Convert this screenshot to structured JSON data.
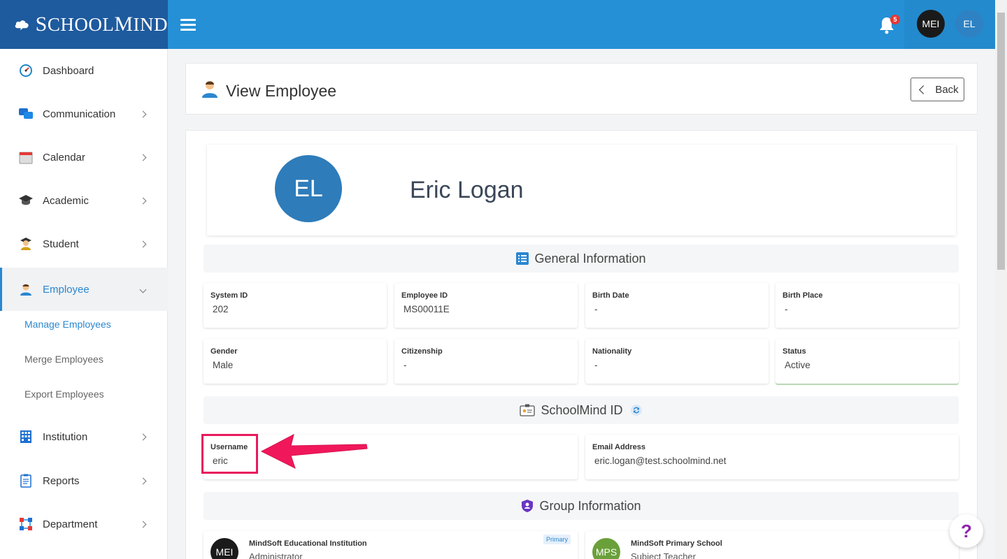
{
  "brand": {
    "name_first_letter": "S",
    "name_part1": "CHOOL",
    "name_second_letter": "M",
    "name_part2": "IND"
  },
  "topbar": {
    "notification_count": "5",
    "user_avatar_mei": "MEI",
    "user_avatar_el": "EL"
  },
  "sidebar": {
    "items": [
      {
        "label": "Dashboard"
      },
      {
        "label": "Communication"
      },
      {
        "label": "Calendar"
      },
      {
        "label": "Academic"
      },
      {
        "label": "Student"
      },
      {
        "label": "Employee"
      },
      {
        "label": "Institution"
      },
      {
        "label": "Reports"
      },
      {
        "label": "Department"
      }
    ],
    "employee_subitems": [
      {
        "label": "Manage Employees"
      },
      {
        "label": "Merge Employees"
      },
      {
        "label": "Export Employees"
      }
    ]
  },
  "header": {
    "title": "View Employee",
    "back_label": "Back"
  },
  "profile": {
    "initials": "EL",
    "name": "Eric Logan"
  },
  "general": {
    "title": "General Information",
    "fields": [
      {
        "label": "System ID",
        "value": "202"
      },
      {
        "label": "Employee ID",
        "value": "MS00011E"
      },
      {
        "label": "Birth Date",
        "value": "-"
      },
      {
        "label": "Birth Place",
        "value": "-"
      },
      {
        "label": "Gender",
        "value": "Male"
      },
      {
        "label": "Citizenship",
        "value": "-"
      },
      {
        "label": "Nationality",
        "value": "-"
      },
      {
        "label": "Status",
        "value": "Active"
      }
    ]
  },
  "schoolmind_id": {
    "title": "SchoolMind ID",
    "fields": [
      {
        "label": "Username",
        "value": "eric"
      },
      {
        "label": "Email Address",
        "value": "eric.logan@test.schoolmind.net"
      }
    ]
  },
  "groups": {
    "title": "Group Information",
    "items": [
      {
        "initials": "MEI",
        "title": "MindSoft Educational Institution",
        "role": "Administrator",
        "badge": "Primary",
        "color": "#1a1a1a"
      },
      {
        "initials": "MPS",
        "title": "MindSoft Primary School",
        "role": "Subject Teacher",
        "color": "#6aa03a"
      }
    ]
  },
  "help_label": "?"
}
